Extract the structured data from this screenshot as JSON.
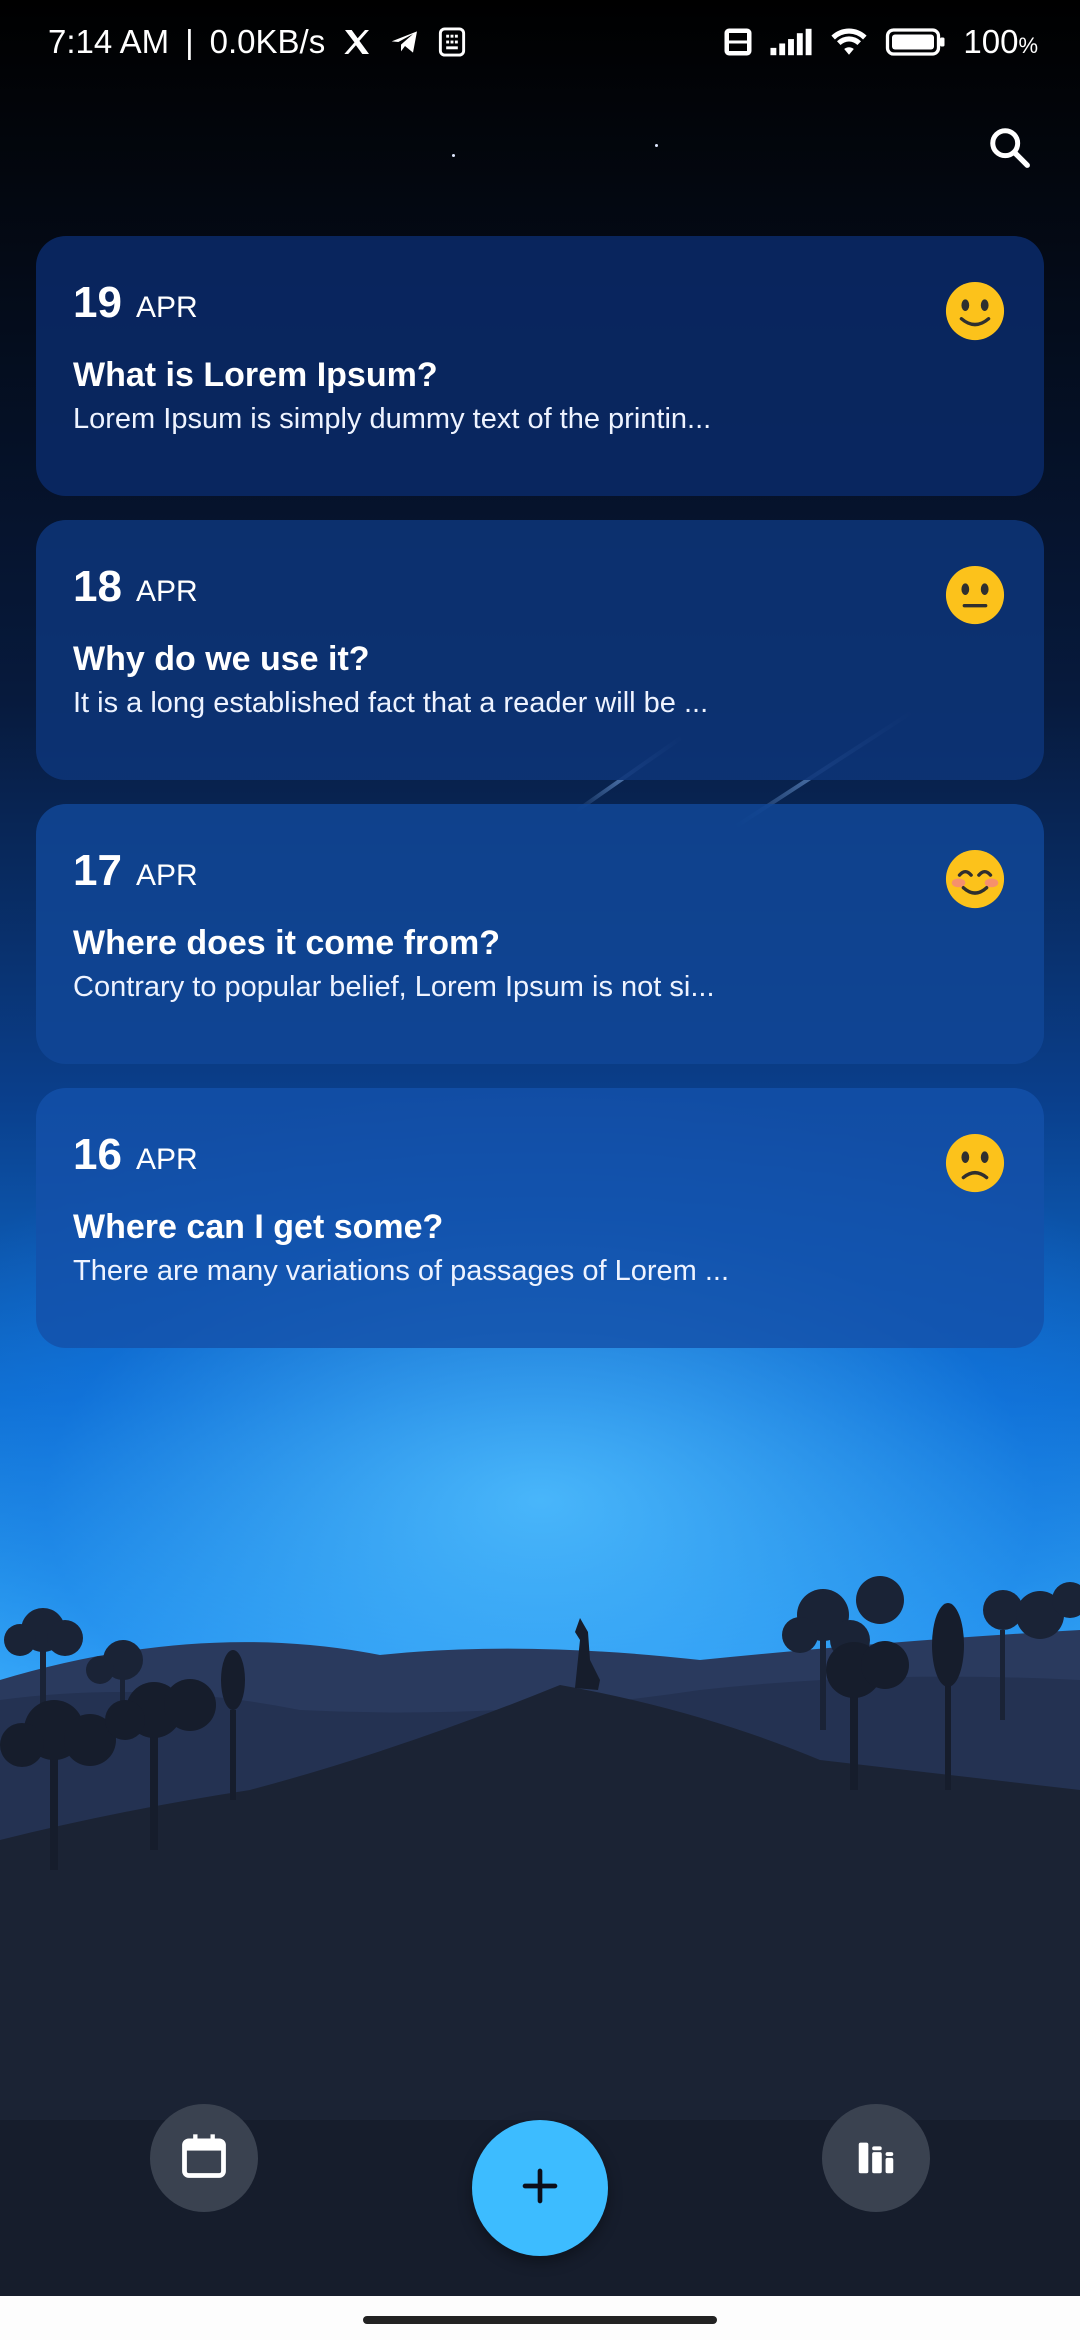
{
  "status_bar": {
    "time": "7:14 AM",
    "separator": "|",
    "speed": "0.0KB/s",
    "battery": "100",
    "battery_unit": "%",
    "left_icons": [
      "x-icon",
      "telegram-icon",
      "sim-toolkit-icon"
    ],
    "right_icons": [
      "volte-icon",
      "signal-icon",
      "wifi-icon",
      "battery-icon"
    ]
  },
  "header": {
    "search_icon": "search-icon"
  },
  "entries": [
    {
      "day": "19",
      "month": "APR",
      "title": "What is Lorem Ipsum?",
      "snippet": "Lorem Ipsum is simply dummy text of the printin...",
      "mood": "slightly-smiling-face"
    },
    {
      "day": "18",
      "month": "APR",
      "title": "Why do we use it?",
      "snippet": "It is a long established fact that a reader will be ...",
      "mood": "neutral-face"
    },
    {
      "day": "17",
      "month": "APR",
      "title": "Where does it come from?",
      "snippet": "Contrary to popular belief, Lorem Ipsum is not si...",
      "mood": "smiling-face-with-blush"
    },
    {
      "day": "16",
      "month": "APR",
      "title": "Where can I get some?",
      "snippet": "There are many variations of passages of Lorem ...",
      "mood": "slightly-frowning-face"
    }
  ],
  "bottom_nav": {
    "left_icon": "calendar-icon",
    "center_icon": "plus-icon",
    "right_icon": "stats-icon"
  },
  "colors": {
    "fab": "#3dbcff",
    "nav_button": "#3a4250",
    "ground": "#161d2c",
    "emoji": "#fcc21b"
  }
}
